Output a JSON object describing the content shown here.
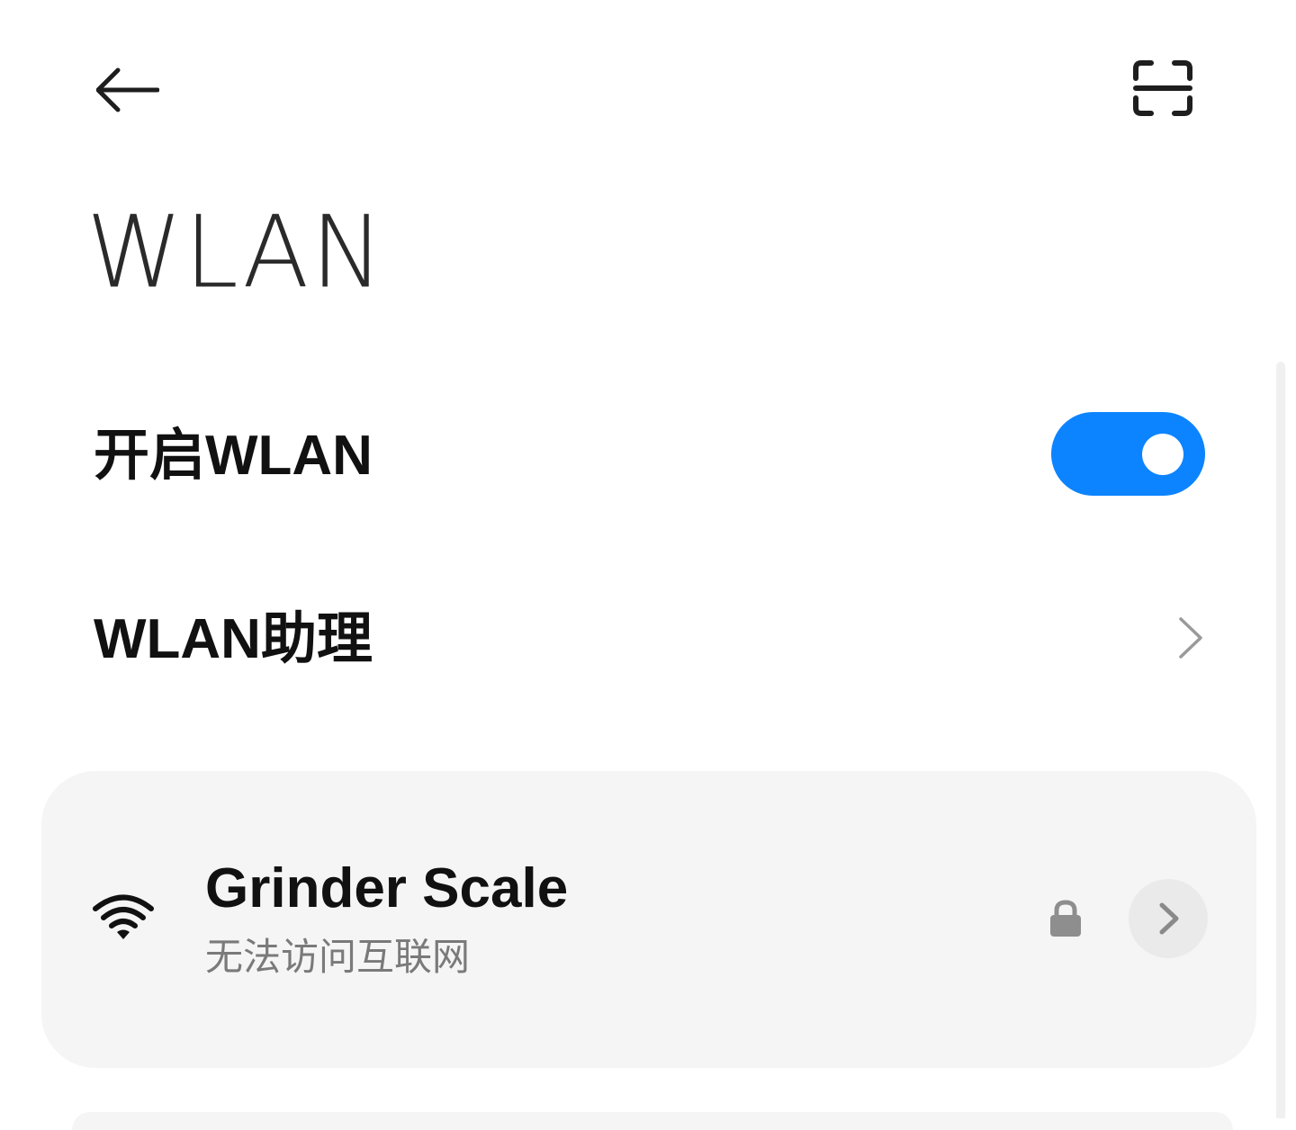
{
  "header": {
    "back_icon": "back-arrow-icon",
    "scan_icon": "scan-icon",
    "title": "WLAN"
  },
  "settings": {
    "enable_wlan": {
      "label": "开启WLAN",
      "enabled": true,
      "toggle_color": "#0d84ff"
    },
    "wlan_assistant": {
      "label": "WLAN助理",
      "icon": "chevron-right-icon"
    }
  },
  "networks": [
    {
      "name": "Grinder Scale",
      "status": "无法访问互联网",
      "signal_icon": "wifi-signal-icon",
      "secured": true,
      "lock_icon": "lock-icon",
      "detail_icon": "chevron-right-icon"
    }
  ]
}
